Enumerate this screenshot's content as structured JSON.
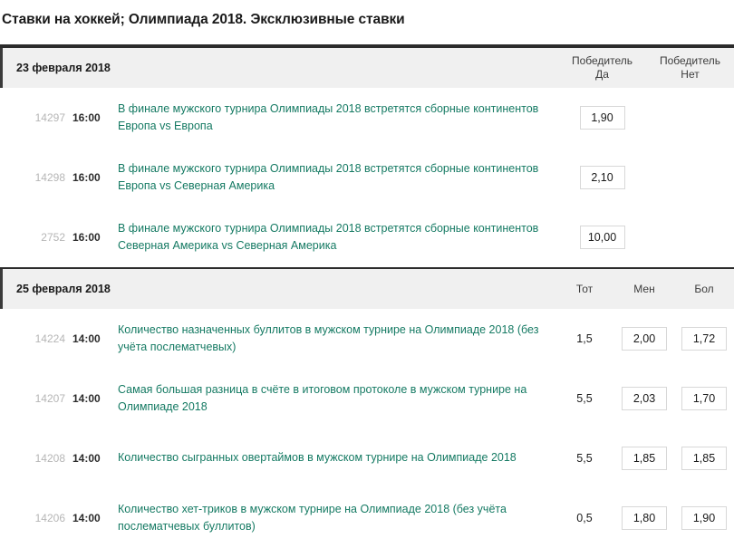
{
  "page": {
    "title": "Ставки на хоккей; Олимпиада 2018. Эксклюзивные ставки"
  },
  "colors": {
    "link_green": "#157a63",
    "header_bg": "#f0f0f0",
    "accent_dark": "#2b2b2b",
    "id_gray": "#b6b6b6",
    "box_border": "#d8d8d8"
  },
  "sections": [
    {
      "date": "23 февраля 2018",
      "layout": "cols-2",
      "columns": [
        {
          "line1": "Победитель",
          "line2": "Да"
        },
        {
          "line1": "Победитель",
          "line2": "Нет"
        }
      ],
      "rows": [
        {
          "id": "14297",
          "time": "16:00",
          "title": "В финале мужского турнира Олимпиады 2018 встретятся сборные континентов Европа vs Европа",
          "odds": [
            {
              "value": "1,90",
              "style": "box"
            },
            {
              "value": "",
              "style": "empty"
            }
          ]
        },
        {
          "id": "14298",
          "time": "16:00",
          "title": "В финале мужского турнира Олимпиады 2018 встретятся сборные континентов Европа vs Северная Америка",
          "odds": [
            {
              "value": "2,10",
              "style": "box"
            },
            {
              "value": "",
              "style": "empty"
            }
          ]
        },
        {
          "id": "2752",
          "time": "16:00",
          "title": "В финале мужского турнира Олимпиады 2018 встретятся сборные континентов Северная Америка vs Северная Америка",
          "odds": [
            {
              "value": "10,00",
              "style": "box"
            },
            {
              "value": "",
              "style": "empty"
            }
          ]
        }
      ]
    },
    {
      "date": "25 февраля 2018",
      "layout": "cols-3",
      "columns": [
        {
          "line1": "Тот",
          "line2": ""
        },
        {
          "line1": "Мен",
          "line2": ""
        },
        {
          "line1": "Бол",
          "line2": ""
        }
      ],
      "rows": [
        {
          "id": "14224",
          "time": "14:00",
          "title": "Количество назначенных буллитов в мужском турнире на Олимпиаде 2018 (без учёта послематчевых)",
          "odds": [
            {
              "value": "1,5",
              "style": "plain"
            },
            {
              "value": "2,00",
              "style": "box"
            },
            {
              "value": "1,72",
              "style": "box"
            }
          ]
        },
        {
          "id": "14207",
          "time": "14:00",
          "title": "Самая большая разница в счёте в итоговом протоколе в мужском турнире на Олимпиаде 2018",
          "odds": [
            {
              "value": "5,5",
              "style": "plain"
            },
            {
              "value": "2,03",
              "style": "box"
            },
            {
              "value": "1,70",
              "style": "box"
            }
          ]
        },
        {
          "id": "14208",
          "time": "14:00",
          "title": "Количество сыгранных овертаймов в мужском турнире на Олимпиаде 2018",
          "odds": [
            {
              "value": "5,5",
              "style": "plain"
            },
            {
              "value": "1,85",
              "style": "box"
            },
            {
              "value": "1,85",
              "style": "box"
            }
          ]
        },
        {
          "id": "14206",
          "time": "14:00",
          "title": "Количество хет-триков в мужском турнире на Олимпиаде 2018 (без учёта послематчевых буллитов)",
          "odds": [
            {
              "value": "0,5",
              "style": "plain"
            },
            {
              "value": "1,80",
              "style": "box"
            },
            {
              "value": "1,90",
              "style": "box"
            }
          ]
        }
      ]
    }
  ]
}
